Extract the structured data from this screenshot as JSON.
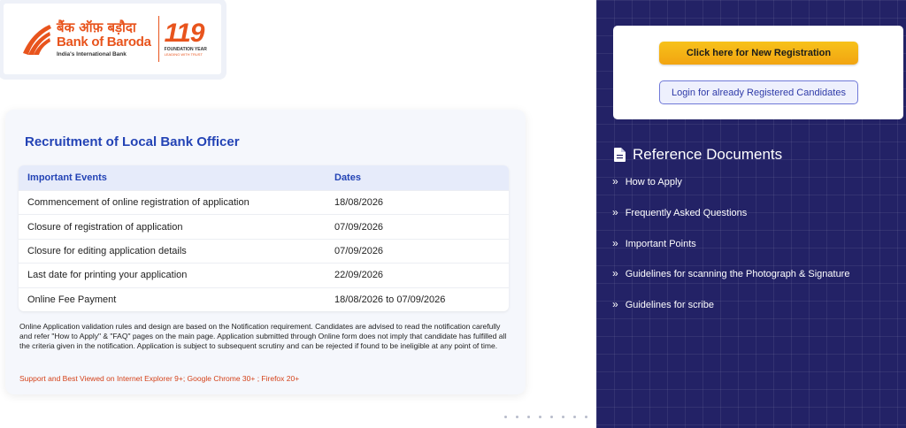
{
  "header": {
    "logo_hindi": "बैंक ऑफ़ बड़ौदा",
    "logo_english": "Bank of Baroda",
    "logo_tagline": "India's International Bank",
    "anniversary_number": "119",
    "anniversary_label": "FOUNDATION YEAR",
    "anniversary_sub": "LEADING WITH TRUST"
  },
  "main": {
    "title": "Recruitment of Local Bank Officer",
    "table": {
      "headers": [
        "Important Events",
        "Dates"
      ],
      "rows": [
        {
          "event": "Commencement of online registration of application",
          "date": "18/08/2026"
        },
        {
          "event": "Closure of registration of application",
          "date": "07/09/2026"
        },
        {
          "event": "Closure for editing application details",
          "date": "07/09/2026"
        },
        {
          "event": "Last date for printing your application",
          "date": "22/09/2026"
        },
        {
          "event": "Online Fee Payment",
          "date": "18/08/2026 to 07/09/2026"
        }
      ]
    },
    "note": "Online Application validation rules and design are based on the Notification requirement. Candidates are advised to read the notification carefully and refer \"How to Apply\" & \"FAQ\" pages on the main page. Application submitted through Online form does not imply that candidate has fulfilled all the criteria given in the notification. Application is subject to subsequent scrutiny and can be rejected if found to be ineligible at any point of time.",
    "support": "Support and Best Viewed on Internet Explorer 9+; Google Chrome 30+ ; Firefox 20+"
  },
  "panel": {
    "new_registration_label": "Click here for New Registration",
    "login_label": "Login for already Registered Candidates",
    "reference_title": "Reference Documents",
    "reference_icon": "document-icon",
    "reference_items": [
      "How to Apply",
      "Frequently Asked Questions",
      "Important Points",
      "Guidelines for scanning the Photograph & Signature",
      "Guidelines for scribe"
    ]
  },
  "colors": {
    "brand_orange": "#e8541d",
    "title_blue": "#2343b5",
    "panel_navy": "#232266",
    "button_yellow": "#f5b315",
    "support_red": "#d4421a"
  }
}
